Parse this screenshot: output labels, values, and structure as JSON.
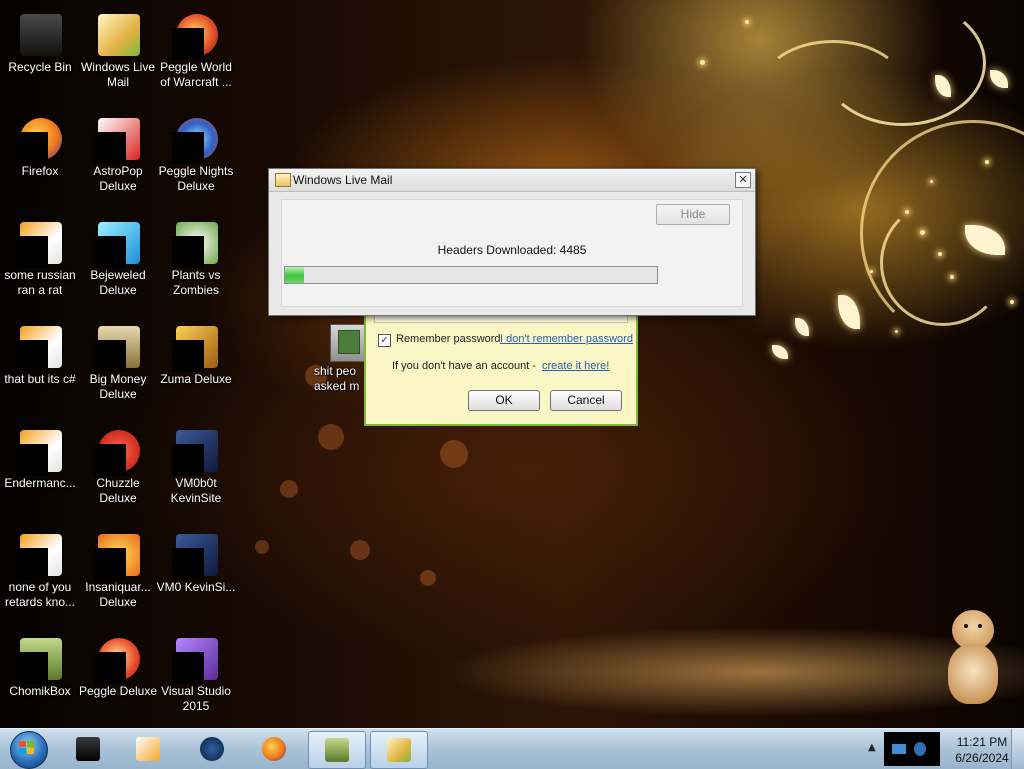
{
  "desktop_icons": [
    {
      "label": "Recycle Bin",
      "icon": "recycle-bin-icon"
    },
    {
      "label": "Windows Live Mail",
      "icon": "windows-live-mail-icon"
    },
    {
      "label": "Peggle World of Warcraft ...",
      "icon": "peggle-wow-icon"
    },
    {
      "label": "Firefox",
      "icon": "firefox-icon"
    },
    {
      "label": "AstroPop Deluxe",
      "icon": "astropop-icon"
    },
    {
      "label": "Peggle Nights Deluxe",
      "icon": "peggle-nights-icon"
    },
    {
      "label": "some russian ran a rat",
      "icon": "shortcut-icon"
    },
    {
      "label": "Bejeweled Deluxe",
      "icon": "bejeweled-icon"
    },
    {
      "label": "Plants vs Zombies",
      "icon": "plants-vs-zombies-icon"
    },
    {
      "label": "that but its c#",
      "icon": "shortcut-icon"
    },
    {
      "label": "Big Money Deluxe",
      "icon": "big-money-icon"
    },
    {
      "label": "Zuma Deluxe",
      "icon": "zuma-icon"
    },
    {
      "label": "Endermanc...",
      "icon": "shortcut-icon"
    },
    {
      "label": "Chuzzle Deluxe",
      "icon": "chuzzle-icon"
    },
    {
      "label": "VM0b0t KevinSite",
      "icon": "vm-icon"
    },
    {
      "label": "none of you retards kno...",
      "icon": "shortcut-icon"
    },
    {
      "label": "Insaniquar... Deluxe",
      "icon": "insaniquarium-icon"
    },
    {
      "label": "VM0 KevinSi...",
      "icon": "vm-icon"
    },
    {
      "label": "ChomikBox",
      "icon": "chomikbox-icon"
    },
    {
      "label": "Peggle Deluxe",
      "icon": "peggle-icon"
    },
    {
      "label": "Visual Studio 2015",
      "icon": "visual-studio-icon"
    },
    {
      "label": "shit peo asked m",
      "icon": "folder-icon"
    }
  ],
  "progress_dialog": {
    "title": "Windows Live Mail",
    "hide_label": "Hide",
    "status_text": "Headers Downloaded: 4485",
    "progress": 0.05,
    "close_glyph": "✕"
  },
  "login_dialog": {
    "remember_label": "Remember password",
    "remember_checked": true,
    "forgot_link": "I don't remember password",
    "account_prompt": "If you don't have an account -",
    "create_link": "create it here!",
    "ok_label": "OK",
    "cancel_label": "Cancel"
  },
  "taskbar": {
    "pinned": [
      {
        "name": "taskbar-app-1",
        "icon": "black-box-icon"
      },
      {
        "name": "taskbar-app-2",
        "icon": "media-player-icon"
      },
      {
        "name": "taskbar-app-3",
        "icon": "globe-icon"
      },
      {
        "name": "taskbar-app-4",
        "icon": "firefox-icon"
      },
      {
        "name": "taskbar-app-5",
        "icon": "chomikbox-icon",
        "active": true
      },
      {
        "name": "taskbar-app-6",
        "icon": "windows-live-mail-icon",
        "active": true
      }
    ],
    "tray_chevron": "▲",
    "clock_time": "11:21 PM",
    "clock_date": "6/26/2024"
  },
  "colors": {
    "progress_fill": "#3fc23f",
    "taskbar": "#a9c2d8",
    "login_bg": "#fbf6c6",
    "link": "#2860b0"
  }
}
